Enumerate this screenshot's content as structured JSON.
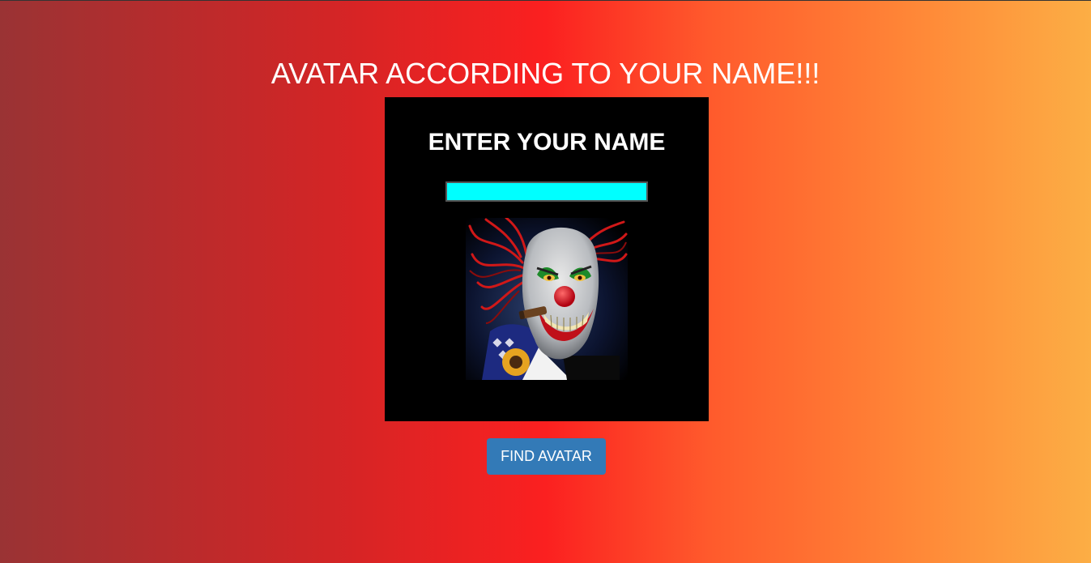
{
  "page": {
    "title": "AVATAR ACCORDING TO YOUR NAME!!!"
  },
  "card": {
    "label": "ENTER YOUR NAME",
    "name_input": {
      "value": "",
      "placeholder": ""
    },
    "avatar": {
      "icon": "clown-avatar-image"
    }
  },
  "actions": {
    "find_label": "FIND AVATAR"
  },
  "colors": {
    "input_background": "#00ffff",
    "button_background": "#337ab7",
    "card_background": "#000000"
  }
}
